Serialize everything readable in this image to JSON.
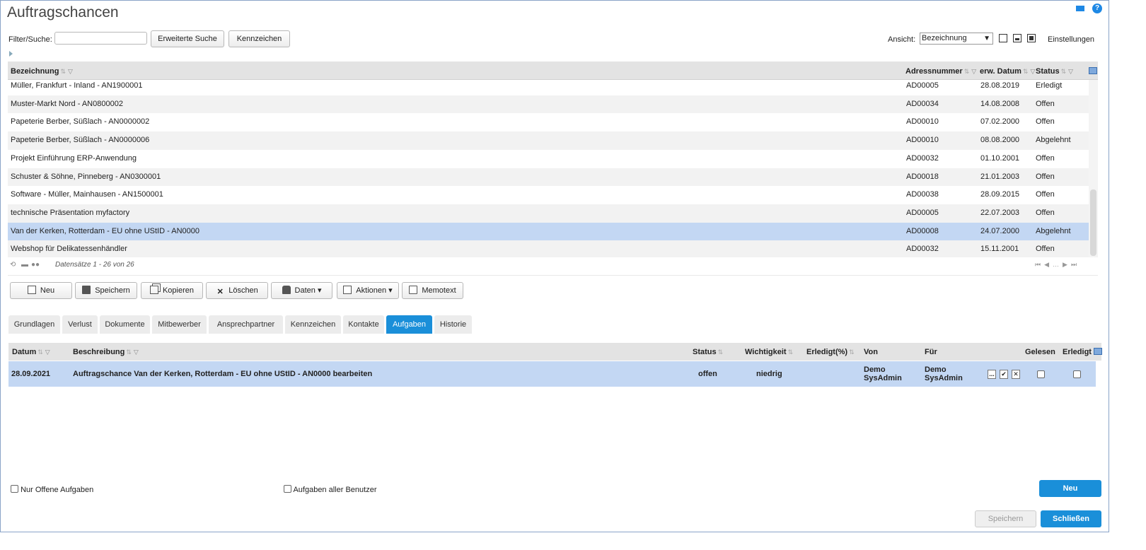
{
  "app": {
    "title": "Auftragschancen"
  },
  "toolbar": {
    "filter_label": "Filter/Suche:",
    "filter_value": "",
    "advanced_search": "Erweiterte Suche",
    "tags_button": "Kennzeichen",
    "view_label": "Ansicht:",
    "view_value": "Bezeichnung",
    "settings": "Einstellungen"
  },
  "grid": {
    "columns": {
      "name": "Bezeichnung",
      "address": "Adressnummer",
      "date": "erw. Datum",
      "status": "Status"
    },
    "rows": [
      {
        "name": "Müller, Frankfurt - Inland - AN1900001",
        "address": "AD00005",
        "date": "28.08.2019",
        "status": "Erledigt"
      },
      {
        "name": "Muster-Markt Nord - AN0800002",
        "address": "AD00034",
        "date": "14.08.2008",
        "status": "Offen"
      },
      {
        "name": "Papeterie Berber, Süßlach - AN0000002",
        "address": "AD00010",
        "date": "07.02.2000",
        "status": "Offen"
      },
      {
        "name": "Papeterie Berber, Süßlach - AN0000006",
        "address": "AD00010",
        "date": "08.08.2000",
        "status": "Abgelehnt"
      },
      {
        "name": "Projekt Einführung ERP-Anwendung",
        "address": "AD00032",
        "date": "01.10.2001",
        "status": "Offen"
      },
      {
        "name": "Schuster & Söhne, Pinneberg - AN0300001",
        "address": "AD00018",
        "date": "21.01.2003",
        "status": "Offen"
      },
      {
        "name": "Software - Müller, Mainhausen - AN1500001",
        "address": "AD00038",
        "date": "28.09.2015",
        "status": "Offen"
      },
      {
        "name": "technische Präsentation myfactory",
        "address": "AD00005",
        "date": "22.07.2003",
        "status": "Offen"
      },
      {
        "name": "Van der Kerken, Rotterdam - EU ohne UStID - AN0000",
        "address": "AD00008",
        "date": "24.07.2000",
        "status": "Abgelehnt"
      },
      {
        "name": "Webshop für Delikatessenhändler",
        "address": "AD00032",
        "date": "15.11.2001",
        "status": "Offen"
      }
    ],
    "records_text": "Datensätze 1 - 26 von 26"
  },
  "actions": {
    "new": "Neu",
    "save": "Speichern",
    "copy": "Kopieren",
    "delete": "Löschen",
    "data": "Daten",
    "actions": "Aktionen",
    "memo": "Memotext"
  },
  "tabs": [
    "Grundlagen",
    "Verlust",
    "Dokumente",
    "Mitbewerber",
    "Ansprechpartner",
    "Kennzeichen",
    "Kontakte",
    "Aufgaben",
    "Historie"
  ],
  "tasks": {
    "columns": {
      "date": "Datum",
      "description": "Beschreibung",
      "status": "Status",
      "priority": "Wichtigkeit",
      "done_pct": "Erledigt(%)",
      "from": "Von",
      "for": "Für",
      "read": "Gelesen",
      "done": "Erledigt"
    },
    "row": {
      "date": "28.09.2021",
      "description": "Auftragschance Van der Kerken, Rotterdam - EU ohne UStID - AN0000 bearbeiten",
      "status": "offen",
      "priority": "niedrig",
      "done_pct": "",
      "from_1": "Demo",
      "from_2": "SysAdmin",
      "for_1": "Demo",
      "for_2": "SysAdmin",
      "btn_more": "...",
      "btn_check": "✔",
      "btn_x": "✕"
    }
  },
  "footer": {
    "only_open": "Nur Offene Aufgaben",
    "all_users": "Aufgaben aller Benutzer",
    "new": "Neu",
    "save": "Speichern",
    "close": "Schließen"
  },
  "colors": {
    "accent": "#1a8fd9",
    "selected_row": "#c3d7f3",
    "header_bg": "#e3e3e3"
  }
}
